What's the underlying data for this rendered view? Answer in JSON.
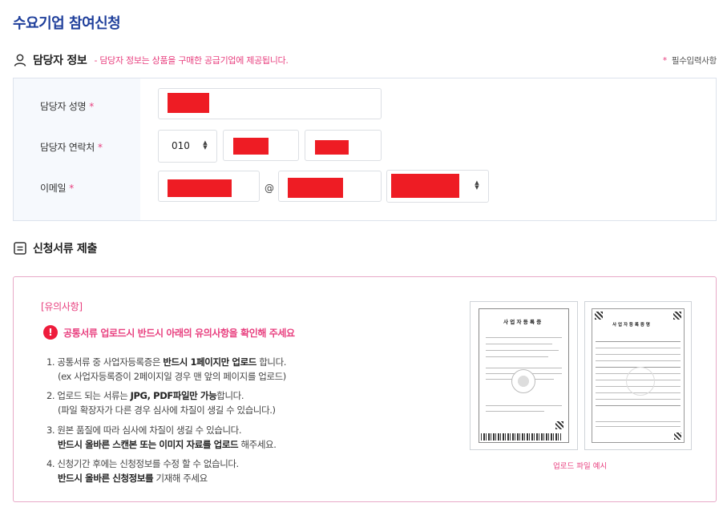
{
  "page": {
    "title": "수요기업 참여신청"
  },
  "contact_section": {
    "title": "담당자 정보",
    "note": "- 담당자 정보는 상품을 구매한 공급기업에 제공됩니다.",
    "required_star": "*",
    "required_legend": "필수입력사항",
    "fields": {
      "name_label": "담당자 성명",
      "phone_label": "담당자 연락처",
      "email_label": "이메일",
      "phone_prefix": "010",
      "email_at": "@"
    }
  },
  "docs_section": {
    "title": "신청서류 제출",
    "notice_title": "[유의사항]",
    "warning_icon": "!",
    "warning": "공통서류 업로드시 반드시 아래의 유의사항을 확인해 주세요",
    "items": [
      {
        "pre": "1. 공통서류 중 사업자등록증은 ",
        "bold": "반드시 1페이지만 업로드",
        "post": " 합니다.",
        "sub": "(ex 사업자등록증이 2페이지일 경우 맨 앞의 페이지를 업로드)"
      },
      {
        "pre": "2. 업로드 되는 서류는 ",
        "bold": "JPG, PDF파일만 가능",
        "post": "합니다.",
        "sub": "(파일 확장자가 다른 경우 심사에 차질이 생길 수 있습니다.)"
      },
      {
        "pre": "3. 원본 품질에 따라 심사에 차질이 생길 수 있습니다.",
        "bold": "",
        "post": "",
        "sub_bold": "반드시 올바른 스캔본 또는 이미지 자료를 업로드",
        "sub_post": " 해주세요."
      },
      {
        "pre": "4. 신청기간 후에는 신청정보를 수정 할 수 없습니다.",
        "bold": "",
        "post": "",
        "sub_bold": "반드시 올바른 신청정보를",
        "sub_post": " 기재해 주세요"
      }
    ],
    "sample_caption": "업로드 파일 예시",
    "sample_doc_1_title": "사 업 자 등 록 증",
    "sample_doc_2_title": "사 업 자 등 록 증 명"
  },
  "colors": {
    "brand": "#1f3f9b",
    "accent": "#e8407f",
    "redaction": "#ee1c24"
  }
}
